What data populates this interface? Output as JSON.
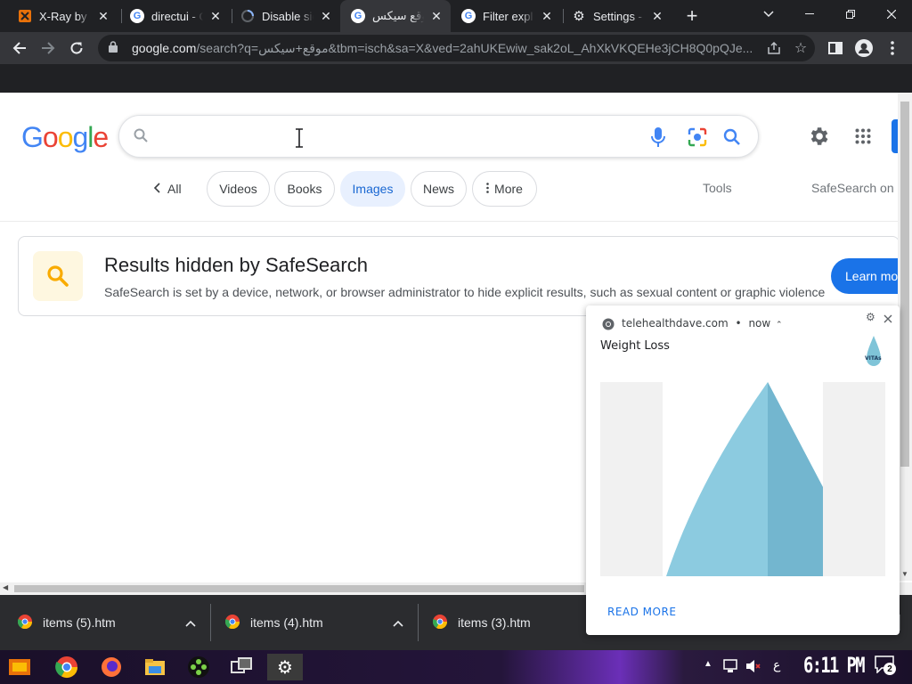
{
  "browser": {
    "tabs": [
      {
        "title": "X-Ray by d",
        "favicon": "xray-icon",
        "active": false
      },
      {
        "title": "directui - G",
        "favicon": "google-icon",
        "active": false
      },
      {
        "title": "Disable sig",
        "favicon": "loading-icon",
        "active": false
      },
      {
        "title": "موقع سيكس",
        "favicon": "google-icon",
        "active": true
      },
      {
        "title": "Filter expl",
        "favicon": "google-icon",
        "active": false
      },
      {
        "title": "Settings - ",
        "favicon": "gear-icon",
        "active": false
      }
    ],
    "new_tab_label": "+",
    "url_host": "google.com",
    "url_rest": "/search?q=موقع+سيكس&tbm=isch&sa=X&ved=2ahUKEwiw_sak2oL_AhXkVKQEHe3jCH8Q0pQJe..."
  },
  "google": {
    "logo_text": "Google",
    "search_value": "",
    "chips": [
      {
        "label": "All",
        "selected": false
      },
      {
        "label": "Videos",
        "selected": false
      },
      {
        "label": "Books",
        "selected": false
      },
      {
        "label": "Images",
        "selected": true
      },
      {
        "label": "News",
        "selected": false
      },
      {
        "label": "More",
        "selected": false
      }
    ],
    "tools_label": "Tools",
    "safesearch_label": "SafeSearch on",
    "card": {
      "title": "Results hidden by SafeSearch",
      "body": "SafeSearch is set by a device, network, or browser administrator to hide explicit results, such as sexual content or graphic violence",
      "button": "Learn mo"
    }
  },
  "notification": {
    "source": "telehealthdave.com",
    "time": "now",
    "title": "Weight Loss",
    "thumb_label": "VITAs",
    "action": "READ MORE"
  },
  "downloads": [
    {
      "name": "items (5).htm"
    },
    {
      "name": "items (4).htm"
    },
    {
      "name": "items (3).htm"
    }
  ],
  "taskbar": {
    "clock": "6:11 PM",
    "notification_count": "2",
    "lang": "ع"
  },
  "colors": {
    "accent_blue": "#1a73e8",
    "chip_selected_bg": "#e8f0fe",
    "chrome_dark": "#202124",
    "toolbar": "#35363a"
  }
}
